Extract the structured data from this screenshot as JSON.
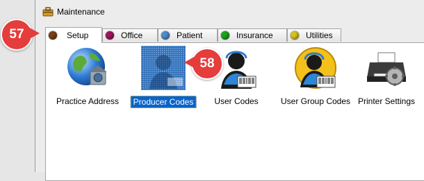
{
  "window": {
    "title": "Maintenance",
    "icon": "maintenance-icon"
  },
  "tabs": [
    {
      "label": "Setup",
      "dot_color": "#7a3f17",
      "active": true
    },
    {
      "label": "Office",
      "dot_color": "#a0165a",
      "active": false
    },
    {
      "label": "Patient",
      "dot_color": "#4a8ecf",
      "active": false
    },
    {
      "label": "Insurance",
      "dot_color": "#1aa51a",
      "active": false
    },
    {
      "label": "Utilities",
      "dot_color": "#d7c21a",
      "active": false
    }
  ],
  "items": [
    {
      "label": "Practice Address",
      "icon": "globe-house-icon",
      "selected": false
    },
    {
      "label": "Producer Codes",
      "icon": "producer-codes-icon",
      "selected": true
    },
    {
      "label": "User Codes",
      "icon": "user-barcode-icon",
      "selected": false
    },
    {
      "label": "User Group Codes",
      "icon": "user-group-barcode-icon",
      "selected": false
    },
    {
      "label": "Printer Settings",
      "icon": "printer-gear-icon",
      "selected": false
    }
  ],
  "callouts": [
    {
      "number": "57"
    },
    {
      "number": "58"
    }
  ],
  "colors": {
    "selection": "#0a64c8",
    "callout": "#e53c3c"
  }
}
